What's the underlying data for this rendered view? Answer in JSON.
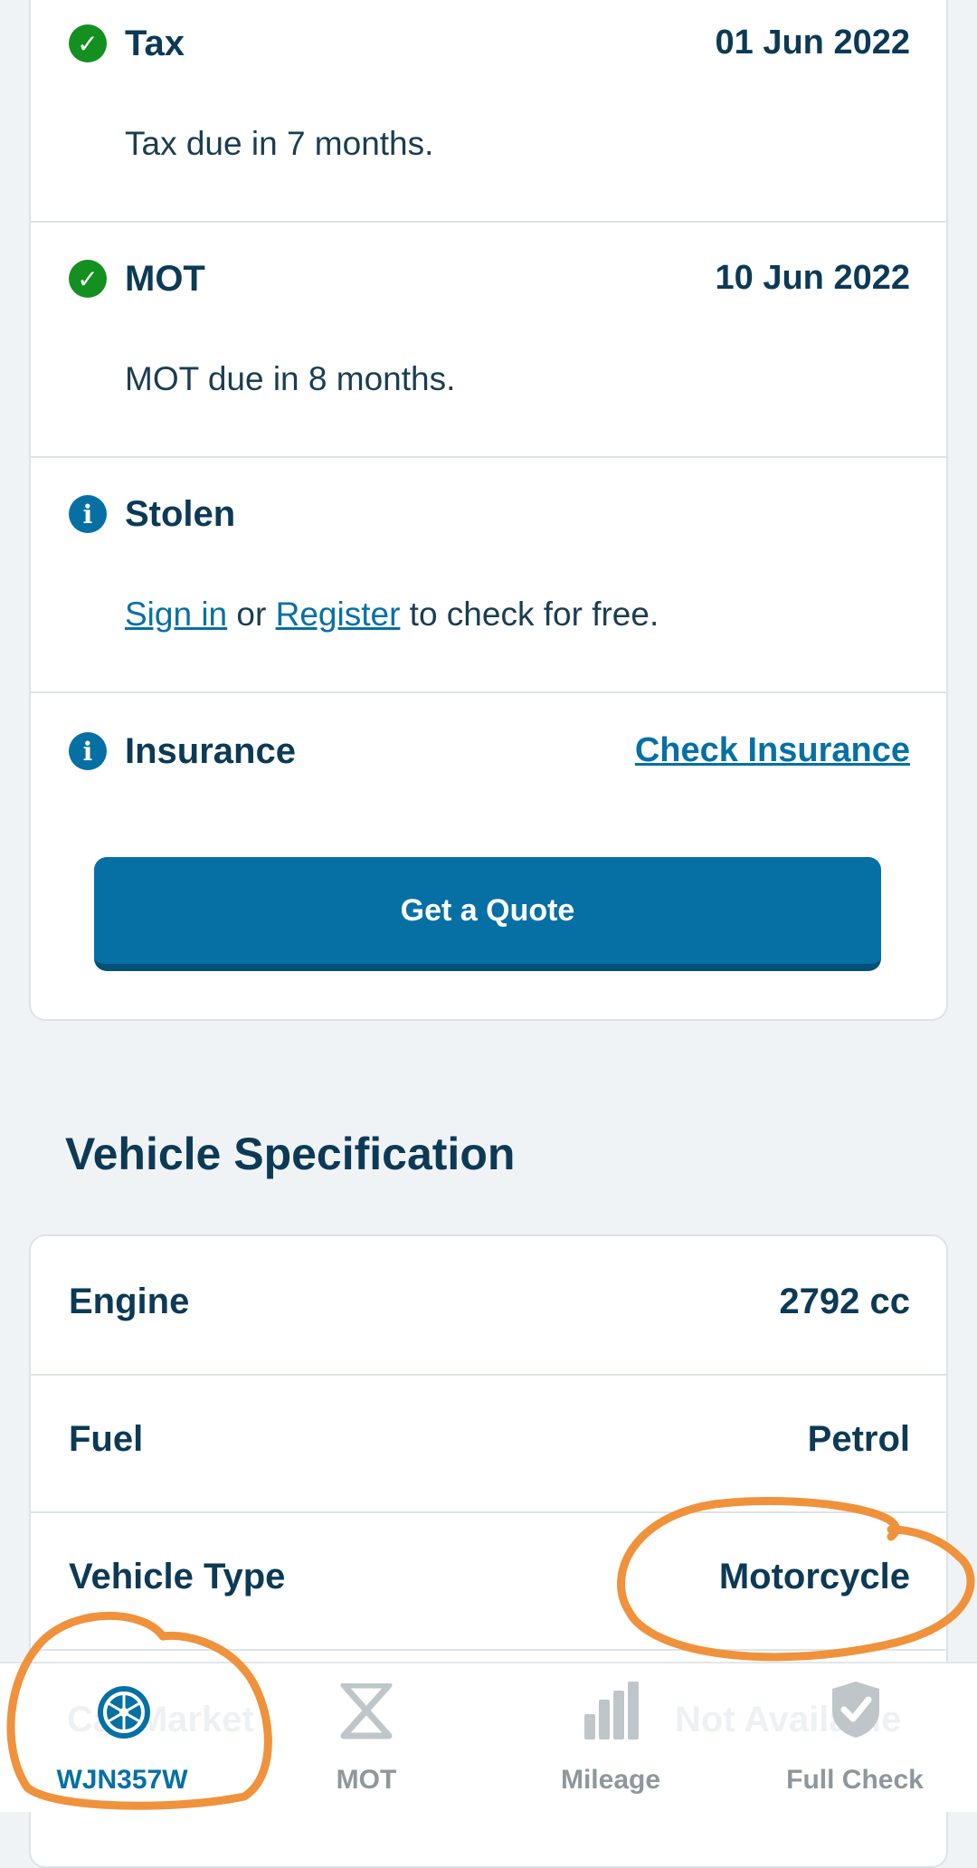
{
  "status": {
    "tax": {
      "title": "Tax",
      "date": "01 Jun 2022",
      "desc": "Tax due in 7 months."
    },
    "mot": {
      "title": "MOT",
      "date": "10 Jun 2022",
      "desc": "MOT due in 8 months."
    },
    "stolen": {
      "title": "Stolen",
      "signin": "Sign in",
      "or": "or",
      "register": "Register",
      "rest": "to check for free."
    },
    "insurance": {
      "title": "Insurance",
      "link": "Check Insurance",
      "button": "Get a Quote"
    }
  },
  "spec": {
    "heading": "Vehicle Specification",
    "rows": [
      {
        "label": "Engine",
        "value": "2792 cc"
      },
      {
        "label": "Fuel",
        "value": "Petrol"
      },
      {
        "label": "Vehicle Type",
        "value": "Motorcycle"
      }
    ]
  },
  "nav": {
    "items": [
      {
        "label": "WJN357W",
        "icon": "wheel-icon",
        "active": true
      },
      {
        "label": "MOT",
        "icon": "mot-triangle-icon",
        "active": false
      },
      {
        "label": "Mileage",
        "icon": "bar-chart-icon",
        "active": false
      },
      {
        "label": "Full Check",
        "icon": "shield-check-icon",
        "active": false
      }
    ],
    "ghost_left": "Car Market",
    "ghost_right": "Not Available"
  },
  "colors": {
    "accent": "#0670a4",
    "success": "#13901f",
    "annotation": "#f0923c"
  }
}
